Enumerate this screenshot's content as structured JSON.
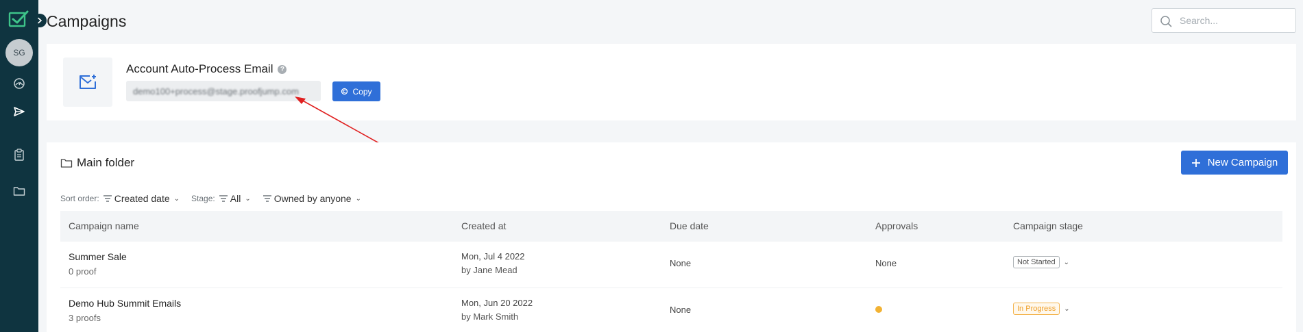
{
  "page": {
    "title": "Campaigns"
  },
  "sidebar": {
    "avatar_initials": "SG",
    "icons": [
      "logo-icon",
      "chevron-right-icon",
      "gauge-icon",
      "send-icon",
      "clipboard-icon",
      "folder-icon"
    ]
  },
  "search": {
    "placeholder": "Search..."
  },
  "email_card": {
    "title": "Account Auto-Process Email",
    "email": "demo100+process@stage.proofjump.com",
    "copy_label": "Copy"
  },
  "main": {
    "folder_label": "Main folder",
    "new_campaign_label": "New Campaign",
    "filters": {
      "sort_label": "Sort order:",
      "sort_value": "Created date",
      "stage_label": "Stage:",
      "stage_value": "All",
      "owner_value": "Owned by anyone"
    },
    "columns": [
      "Campaign name",
      "Created at",
      "Due date",
      "Approvals",
      "Campaign stage"
    ],
    "rows": [
      {
        "name": "Summer Sale",
        "proofs": "0 proof",
        "created_date": "Mon, Jul 4 2022",
        "created_by": "by Jane Mead",
        "due": "None",
        "approvals": "None",
        "stage": "Not Started"
      },
      {
        "name": "Demo Hub Summit Emails",
        "proofs": "3 proofs",
        "created_date": "Mon, Jun 20 2022",
        "created_by": "by Mark Smith",
        "due": "None",
        "approvals": "",
        "stage": "In Progress"
      }
    ]
  },
  "colors": {
    "sidebar_bg": "#0f3440",
    "accent": "#2f6fd8",
    "logo_green": "#3ec48a",
    "status_in_progress": "#ef9d23",
    "annotation_arrow": "#e02020"
  }
}
